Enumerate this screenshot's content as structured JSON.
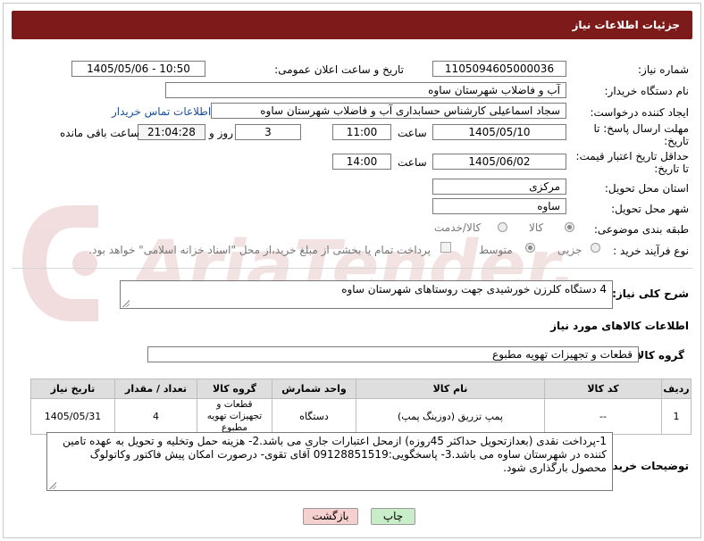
{
  "header": {
    "title": "جزئیات اطلاعات نیاز"
  },
  "fields": {
    "need_number_label": "شماره نیاز:",
    "need_number": "1105094605000036",
    "announce_label": "تاریخ و ساعت اعلان عمومی:",
    "announce_value": "1405/05/06 - 10:50",
    "buyer_org_label": "نام دستگاه خریدار:",
    "buyer_org": "آب و فاضلاب شهرستان ساوه",
    "requester_label": "ایجاد کننده درخواست:",
    "requester": "سجاد اسماعیلی کارشناس حسابداری آب و فاضلاب شهرستان ساوه",
    "contact_link": "اطلاعات تماس خریدار",
    "deadline_label_1": "مهلت ارسال پاسخ: تا",
    "deadline_label_2": "تاریخ:",
    "deadline_date": "1405/05/10",
    "time_label": "ساعت",
    "deadline_time": "11:00",
    "days_value": "3",
    "days_label": "روز و",
    "remaining_time": "21:04:28",
    "remaining_label": "ساعت باقی مانده",
    "price_validity_label_1": "حداقل تاریخ اعتبار قیمت:",
    "price_validity_label_2": "تا تاریخ:",
    "validity_date": "1405/06/02",
    "validity_time": "14:00",
    "province_label": "استان محل تحویل:",
    "province": "مرکزی",
    "city_label": "شهر محل تحویل:",
    "city": "ساوه",
    "category_label": "طبقه بندی موضوعی:",
    "category_options": [
      "کالا",
      "کالا/خدمت"
    ],
    "process_label": "نوع فرآیند خرید :",
    "process_options": [
      "جزیی",
      "متوسط"
    ],
    "payment_note": "پرداخت تمام یا بخشی از مبلغ خرید،از محل \"اسناد خزانه اسلامی\" خواهد بود."
  },
  "description": {
    "label": "شرح کلی نیاز:",
    "value": "4 دستگاه کلرزن خورشیدی جهت روستاهای شهرستان ساوه"
  },
  "goods": {
    "section_title": "اطلاعات کالاهای مورد نیاز",
    "group_label": "گروه کالا:",
    "group_value": "قطعات و تجهیزات تهویه مطبوع"
  },
  "table": {
    "headers": [
      "ردیف",
      "کد کالا",
      "نام کالا",
      "واحد شمارش",
      "گروه کالا",
      "تعداد / مقدار",
      "تاریخ نیاز"
    ],
    "rows": [
      [
        "1",
        "--",
        "پمپ تزریق (دوزینگ پمپ)",
        "دستگاه",
        "قطعات و تجهیزات تهویه مطبوع",
        "4",
        "1405/05/31"
      ]
    ]
  },
  "buyer_notes": {
    "label": "توضیحات خریدار:",
    "value": "1-پرداخت  نقدی (بعدازتحویل حداکثر 45روزه) ازمحل اعتبارات جاری می باشد.2- هزینه حمل وتخلیه و تحویل به عهده تامین کننده در شهرستان ساوه می باشد.3- پاسخگویی:09128851519 آقای تقوی- درصورت امکان پیش فاکتور وکاتولوگ محصول بارگذاری شود."
  },
  "buttons": {
    "print": "چاپ",
    "back": "بازگشت"
  },
  "watermark": {
    "text": "AriaTender.net"
  },
  "colors": {
    "header": "#7d1b1b",
    "print_btn": "#c9ecc9",
    "back_btn": "#f6cfcf",
    "link": "#1a4fa0"
  }
}
